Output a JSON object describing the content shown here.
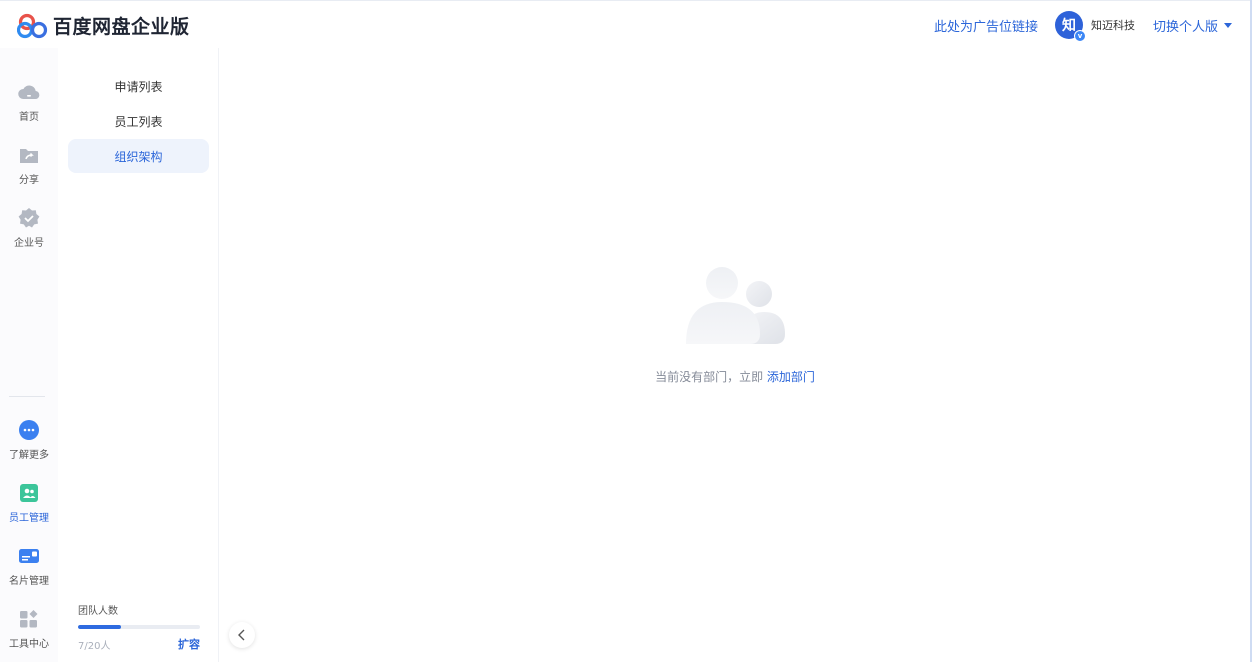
{
  "header": {
    "app_title": "百度网盘企业版",
    "ad_link": "此处为广告位链接",
    "avatar_text": "知",
    "avatar_badge": "v",
    "company_name": "知迈科技",
    "switch_label": "切换个人版"
  },
  "rail": {
    "items": [
      {
        "label": "首页",
        "icon": "cloud-icon"
      },
      {
        "label": "分享",
        "icon": "share-folder-icon"
      },
      {
        "label": "企业号",
        "icon": "enterprise-badge-icon"
      },
      {
        "label": "了解更多",
        "icon": "more-icon"
      },
      {
        "label": "员工管理",
        "icon": "staff-management-icon"
      },
      {
        "label": "名片管理",
        "icon": "business-card-icon"
      },
      {
        "label": "工具中心",
        "icon": "tools-grid-icon"
      }
    ]
  },
  "submenu": {
    "items": [
      {
        "label": "申请列表"
      },
      {
        "label": "员工列表"
      },
      {
        "label": "组织架构"
      }
    ],
    "team": {
      "title": "团队人数",
      "count": "7/20人",
      "used": 7,
      "total": 20,
      "expand": "扩容"
    }
  },
  "main": {
    "empty_text": "当前没有部门，立即 ",
    "empty_link": "添加部门"
  },
  "colors": {
    "accent": "#2c66d9",
    "active_bg": "#eef3fc",
    "progress": "#2e6be0"
  }
}
